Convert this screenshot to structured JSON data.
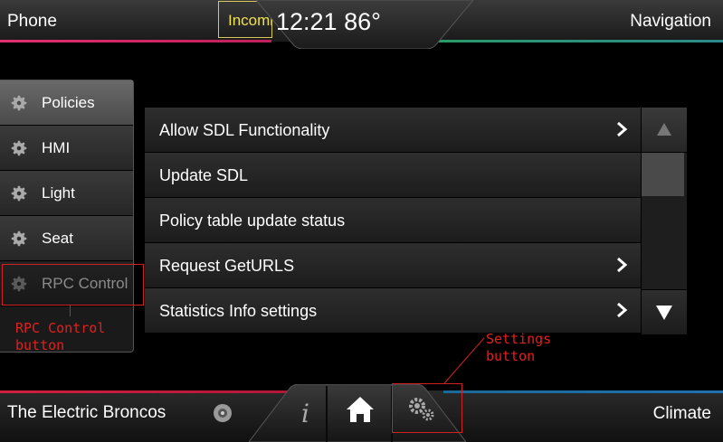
{
  "topbar": {
    "left_label": "Phone",
    "right_label": "Navigation",
    "incoming_label": "Incoming",
    "clock": "12:21 86°"
  },
  "sidebar": {
    "items": [
      {
        "label": "Policies",
        "icon": "gear-icon",
        "state": "selected"
      },
      {
        "label": "HMI",
        "icon": "gear-icon",
        "state": "normal"
      },
      {
        "label": "Light",
        "icon": "gear-icon",
        "state": "normal"
      },
      {
        "label": "Seat",
        "icon": "gear-icon",
        "state": "normal"
      },
      {
        "label": "RPC Control",
        "icon": "gear-icon",
        "state": "disabled"
      }
    ]
  },
  "list": {
    "rows": [
      {
        "label": "Allow SDL Functionality",
        "has_chevron": true
      },
      {
        "label": "Update SDL",
        "has_chevron": false
      },
      {
        "label": "Policy table update status",
        "has_chevron": false
      },
      {
        "label": "Request GetURLS",
        "has_chevron": true
      },
      {
        "label": "Statistics Info settings",
        "has_chevron": true
      }
    ],
    "scroll_up_icon": "triangle-up-icon",
    "scroll_down_icon": "triangle-down-icon"
  },
  "annotations": {
    "rpc_line1": "RPC Control",
    "rpc_line2": "button",
    "settings_line1": "Settings",
    "settings_line2": "button"
  },
  "bottombar": {
    "source_label": "The Electric Broncos",
    "source_icon": "disc-icon",
    "climate_label": "Climate",
    "dock_icons": [
      "info-icon",
      "home-icon",
      "settings-icon"
    ]
  },
  "colors": {
    "phone_accent": "#e03070",
    "nav_accent": "#2a9a6a",
    "audio_accent": "#d02040",
    "climate_accent": "#2070b0",
    "annotation": "#e02020",
    "incoming": "#f0e050"
  }
}
